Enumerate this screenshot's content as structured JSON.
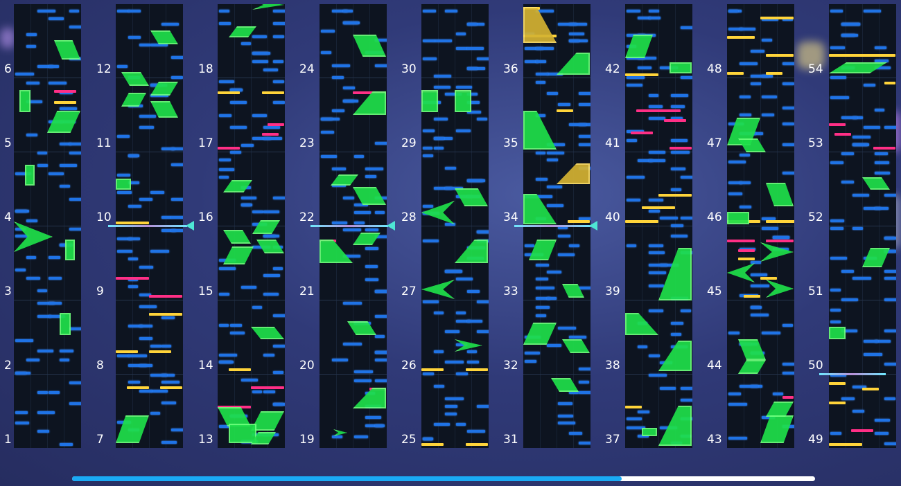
{
  "colors": {
    "tap": "#1f73e6",
    "yellow": "#ffd43a",
    "pink": "#ff2f86",
    "slide": "#1fe04a",
    "progress_fill": "#1aaaf5",
    "progress_track": "#ffffff"
  },
  "progress": {
    "fraction": 0.74
  },
  "columns": [
    {
      "labels": [
        "6",
        "5",
        "4",
        "3",
        "2",
        "1"
      ]
    },
    {
      "labels": [
        "12",
        "11",
        "10",
        "9",
        "8",
        "7"
      ]
    },
    {
      "labels": [
        "18",
        "17",
        "16",
        "15",
        "14",
        "13"
      ]
    },
    {
      "labels": [
        "24",
        "23",
        "22",
        "21",
        "20",
        "19"
      ]
    },
    {
      "labels": [
        "30",
        "29",
        "28",
        "27",
        "26",
        "25"
      ]
    },
    {
      "labels": [
        "36",
        "35",
        "34",
        "33",
        "32",
        "31"
      ]
    },
    {
      "labels": [
        "42",
        "41",
        "40",
        "39",
        "38",
        "37"
      ]
    },
    {
      "labels": [
        "48",
        "47",
        "46",
        "45",
        "44",
        "43"
      ]
    },
    {
      "labels": [
        "54",
        "53",
        "52",
        "51",
        "50",
        "49"
      ]
    }
  ]
}
